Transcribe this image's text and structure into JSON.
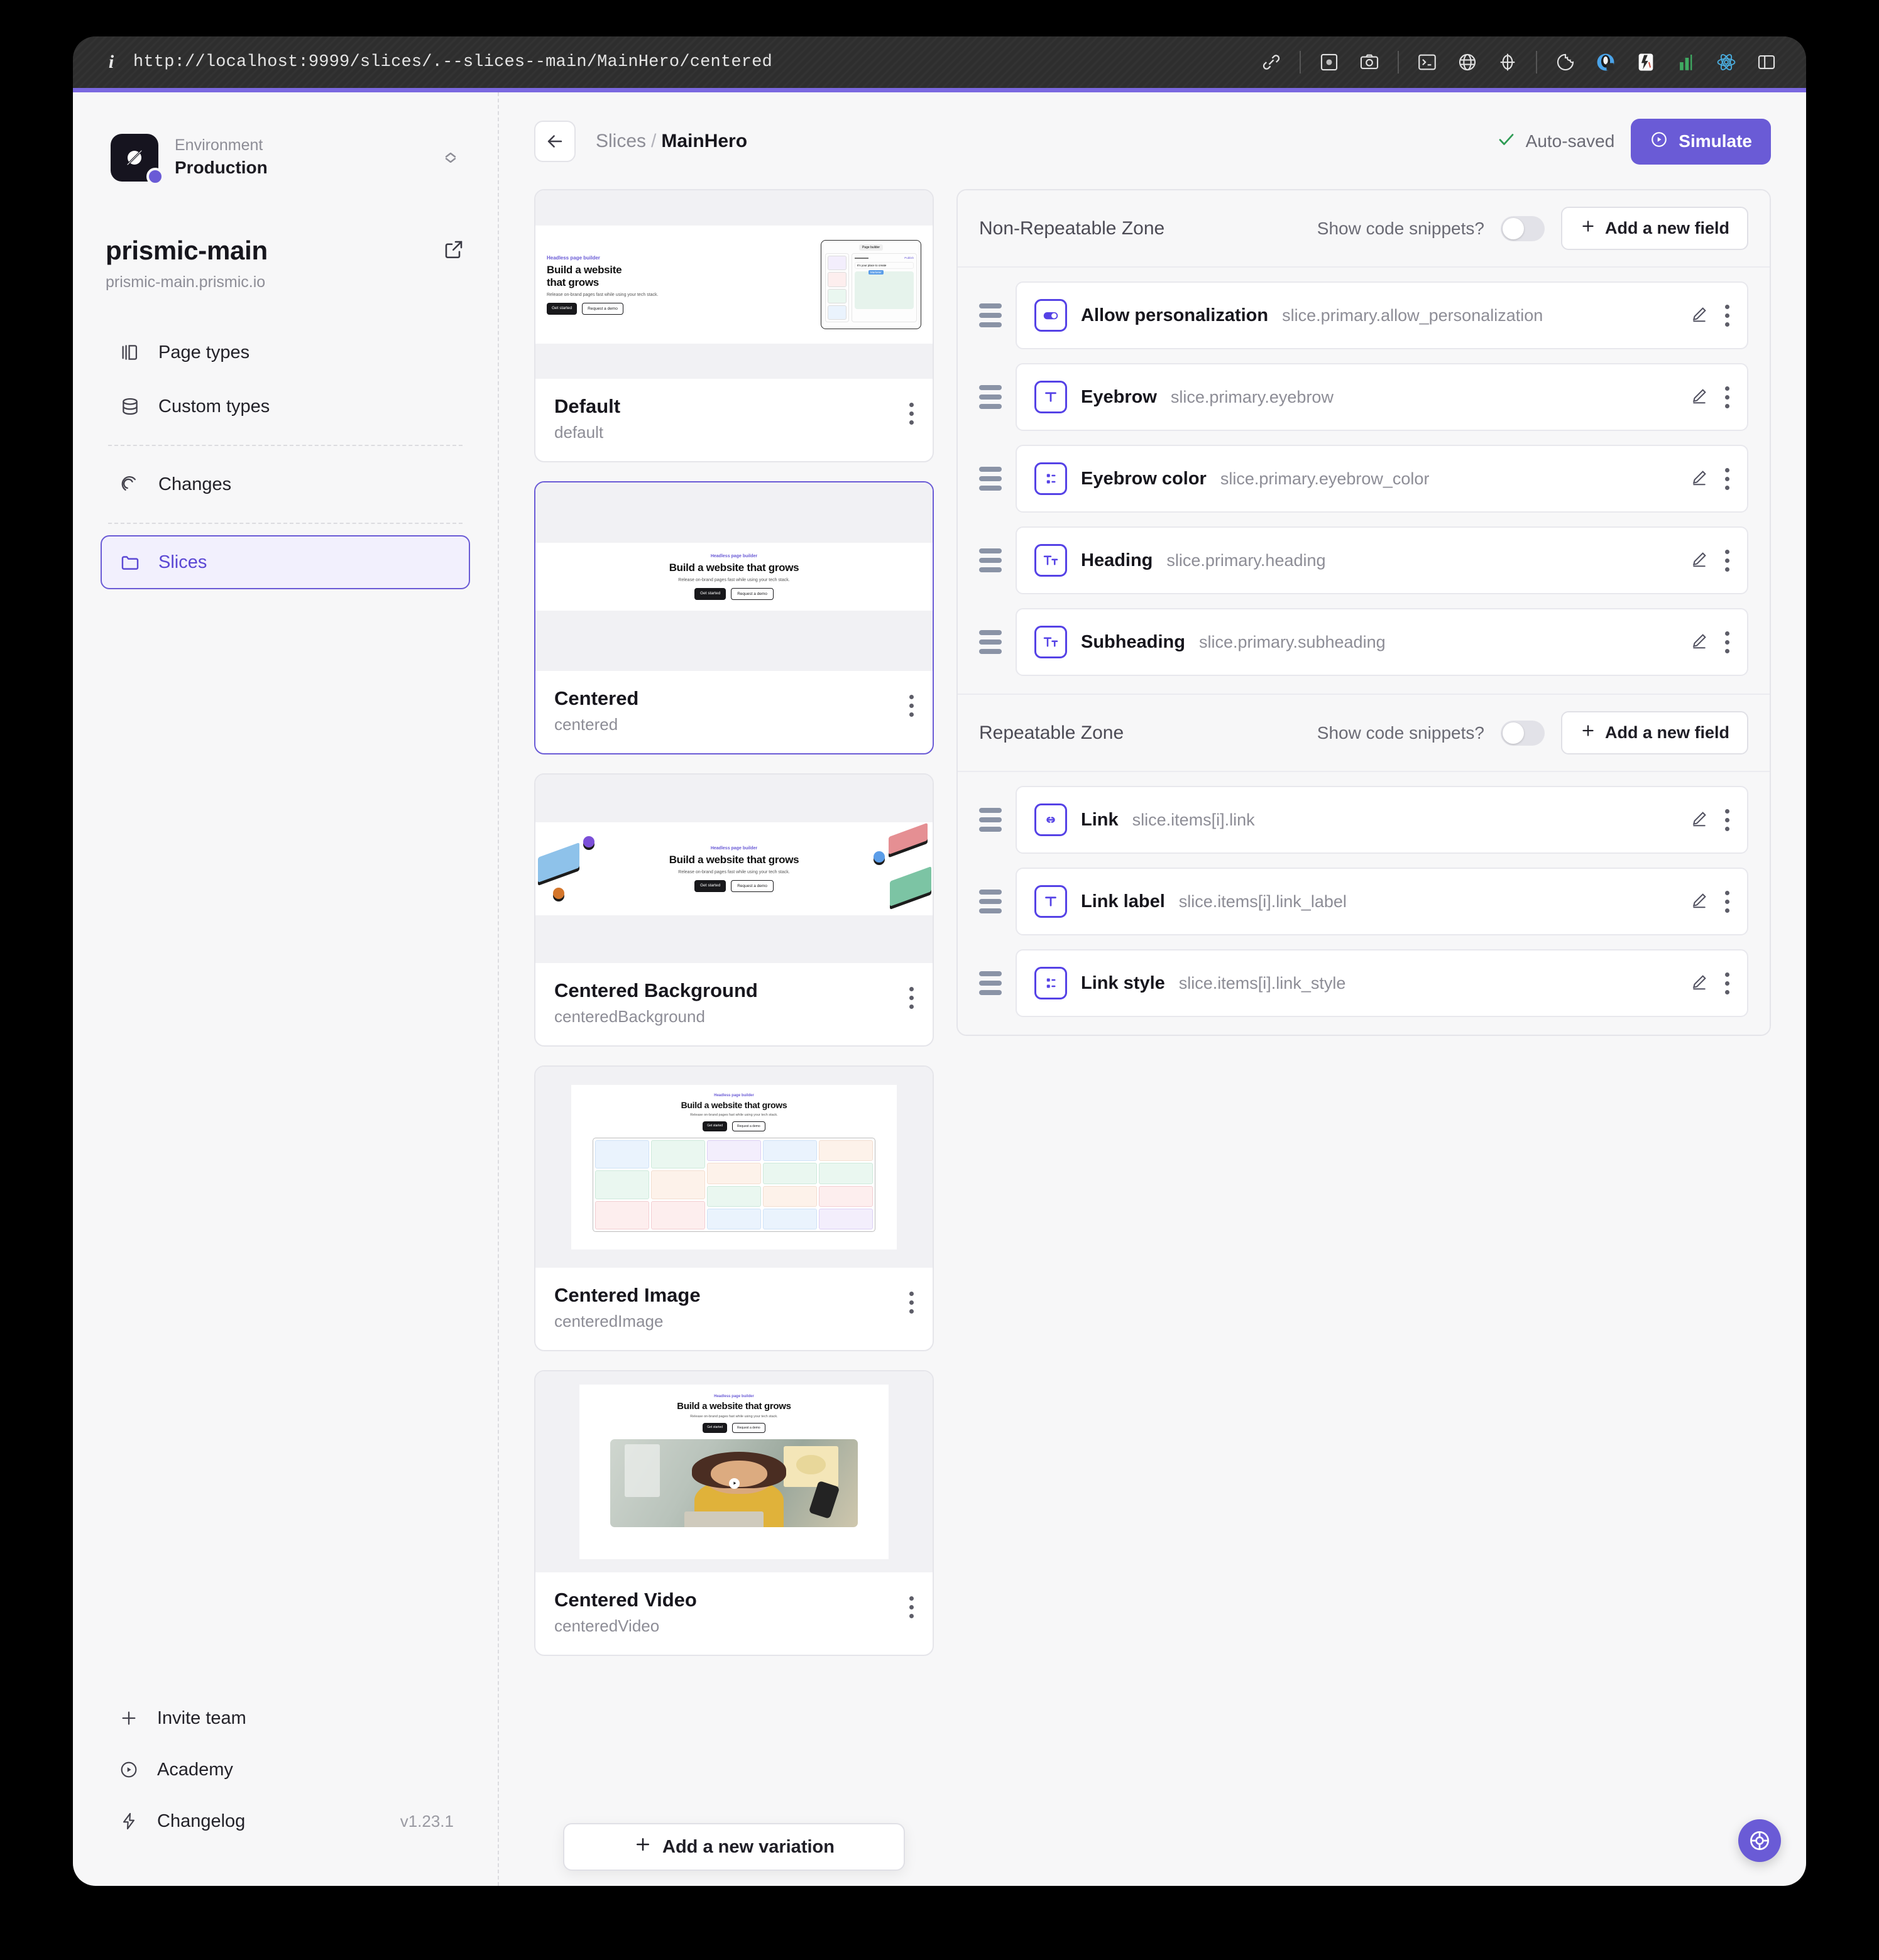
{
  "browser": {
    "url": "http://localhost:9999/slices/.--slices--main/MainHero/centered",
    "info_icon": "info-icon",
    "toolbar_icons": [
      "link-icon",
      "screenshot-icon",
      "camera-icon",
      "terminal-icon",
      "globe-icon",
      "target-icon",
      "cookie-icon",
      "privacy-badger-icon",
      "ublock-icon",
      "metrics-icon",
      "react-devtools-icon",
      "panel-toggle-icon"
    ]
  },
  "sidebar": {
    "environment": {
      "label": "Environment",
      "value": "Production"
    },
    "repo": {
      "name": "prismic-main",
      "domain": "prismic-main.prismic.io"
    },
    "nav": [
      {
        "label": "Page types",
        "icon": "page-types-icon",
        "active": false
      },
      {
        "label": "Custom types",
        "icon": "custom-types-icon",
        "active": false
      },
      {
        "label": "Changes",
        "icon": "changes-icon",
        "active": false
      },
      {
        "label": "Slices",
        "icon": "slices-folder-icon",
        "active": true
      }
    ],
    "footer": [
      {
        "label": "Invite team",
        "icon": "plus-icon",
        "meta": ""
      },
      {
        "label": "Academy",
        "icon": "play-circle-icon",
        "meta": ""
      },
      {
        "label": "Changelog",
        "icon": "lightning-icon",
        "meta": "v1.23.1"
      }
    ]
  },
  "header": {
    "back_icon": "arrow-left-icon",
    "breadcrumb_root": "Slices",
    "breadcrumb_sep": "/",
    "breadcrumb_current": "MainHero",
    "autosaved": "Auto-saved",
    "simulate": "Simulate"
  },
  "preview_text": {
    "eyebrow": "Headless page builder",
    "heading": "Build a website that grows",
    "heading_line1": "Build a website",
    "heading_line2": "that grows",
    "subheading": "Release on-brand pages fast while using your tech stack.",
    "btn_primary": "Get started",
    "btn_secondary": "Request a demo",
    "page_builder_label": "Page builder",
    "publish_label": "Publish",
    "its_your_place": "It's your place to create",
    "marketer_label": "Marketer"
  },
  "variations": [
    {
      "title": "Default",
      "id": "default",
      "layout": "split",
      "selected": false
    },
    {
      "title": "Centered",
      "id": "centered",
      "layout": "centered",
      "selected": true
    },
    {
      "title": "Centered Background",
      "id": "centeredBackground",
      "layout": "centeredBackground",
      "selected": false
    },
    {
      "title": "Centered Image",
      "id": "centeredImage",
      "layout": "centeredImage",
      "selected": false
    },
    {
      "title": "Centered Video",
      "id": "centeredVideo",
      "layout": "centeredVideo",
      "selected": false
    }
  ],
  "add_variation": "Add a new variation",
  "zones": [
    {
      "title": "Non-Repeatable Zone",
      "snippets_label": "Show code snippets?",
      "snippets_on": false,
      "add_field": "Add a new field",
      "fields": [
        {
          "name": "Allow personalization",
          "path": "slice.primary.allow_personalization",
          "icon": "boolean-toggle-icon"
        },
        {
          "name": "Eyebrow",
          "path": "slice.primary.eyebrow",
          "icon": "text-field-icon"
        },
        {
          "name": "Eyebrow color",
          "path": "slice.primary.eyebrow_color",
          "icon": "select-field-icon"
        },
        {
          "name": "Heading",
          "path": "slice.primary.heading",
          "icon": "rich-text-icon"
        },
        {
          "name": "Subheading",
          "path": "slice.primary.subheading",
          "icon": "rich-text-icon"
        }
      ]
    },
    {
      "title": "Repeatable Zone",
      "snippets_label": "Show code snippets?",
      "snippets_on": false,
      "add_field": "Add a new field",
      "fields": [
        {
          "name": "Link",
          "path": "slice.items[i].link",
          "icon": "link-field-icon"
        },
        {
          "name": "Link label",
          "path": "slice.items[i].link_label",
          "icon": "text-field-icon"
        },
        {
          "name": "Link style",
          "path": "slice.items[i].link_style",
          "icon": "select-field-icon"
        }
      ]
    }
  ],
  "help_button": "help-lifebuoy-icon",
  "colors": {
    "accent": "#6a5bd6",
    "field_icon": "#5542e6",
    "app_bg": "#f7f7f8",
    "titlebar": "#2e2e2e",
    "success": "#2f9c55"
  }
}
